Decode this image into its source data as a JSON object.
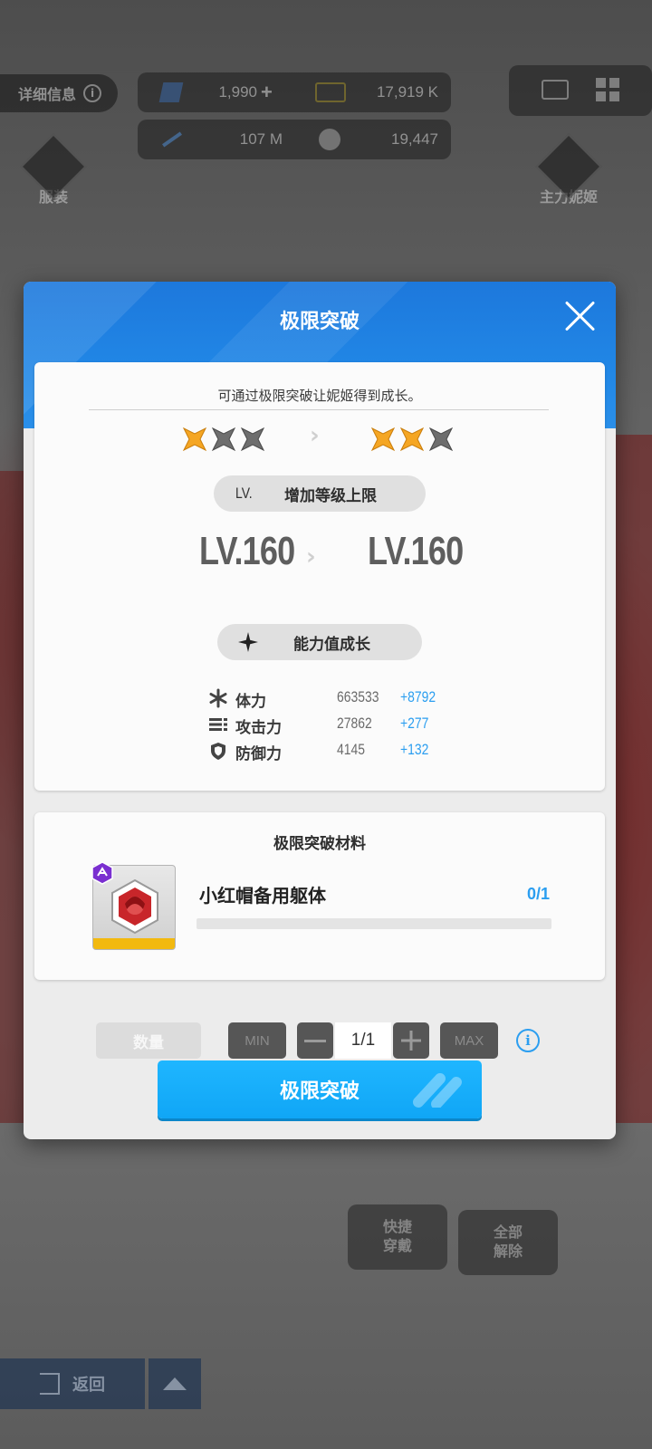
{
  "background": {
    "detail_label": "详细信息",
    "info_symbol": "i",
    "currencies": [
      {
        "icon": "ticket-icon",
        "value": "1,990"
      },
      {
        "icon": "credit-icon",
        "value": "17,919 K"
      },
      {
        "icon": "arrow-icon",
        "value": "107 M"
      },
      {
        "icon": "core-icon",
        "value": "19,447"
      }
    ],
    "add_symbol": "+",
    "costume_label": "服装",
    "main_nikke_label": "主力妮姬",
    "quick_equip_label": "快捷\n穿戴",
    "unequip_all_label": "全部\n解除",
    "back_label": "返回"
  },
  "modal": {
    "title": "极限突破",
    "description": "可通过极限突破让妮姬得到成长。",
    "stars_before": {
      "filled": 1,
      "total": 3
    },
    "stars_after": {
      "filled": 2,
      "total": 3
    },
    "arrow": "›",
    "level_section": {
      "prefix": "LV.",
      "label": "增加等级上限",
      "from": "LV.160",
      "to": "LV.160"
    },
    "growth_section": {
      "label": "能力值成长",
      "stats": [
        {
          "icon": "hp-icon",
          "name": "体力",
          "value": "663533",
          "increase": "+8792"
        },
        {
          "icon": "attack-icon",
          "name": "攻击力",
          "value": "27862",
          "increase": "+277"
        },
        {
          "icon": "defense-icon",
          "name": "防御力",
          "value": "4145",
          "increase": "+132"
        }
      ]
    },
    "materials": {
      "title": "极限突破材料",
      "item_name": "小红帽备用躯体",
      "count": "0/1",
      "progress": 0
    },
    "quantity": {
      "label": "数量",
      "min_label": "MIN",
      "minus": "—",
      "value": "1/1",
      "plus": "+",
      "max_label": "MAX",
      "info_symbol": "i"
    },
    "confirm_label": "极限突破"
  },
  "colors": {
    "accent_blue": "#2b9ef0",
    "header_blue": "#1d78dc",
    "star_gold": "#f5a623",
    "star_gray": "#6e6e6e",
    "item_bar": "#f2b90f"
  }
}
